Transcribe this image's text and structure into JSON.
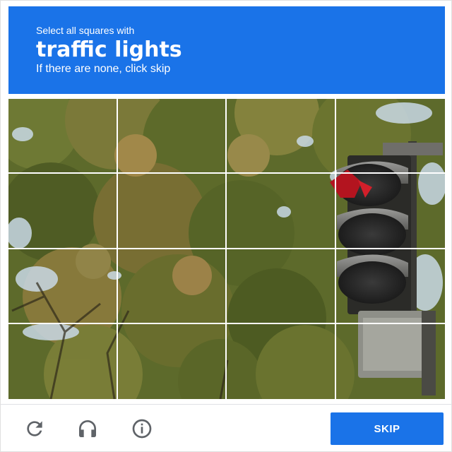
{
  "header": {
    "instruction": "Select all squares with",
    "target": "traffic lights",
    "hint": "If there are none, click skip"
  },
  "grid": {
    "rows": 4,
    "columns": 4,
    "image_description_icons": [
      "tree-foliage",
      "traffic-light"
    ]
  },
  "footer": {
    "reload_icon": "reload-icon",
    "audio_icon": "headphones-icon",
    "info_icon": "info-icon",
    "skip_label": "SKIP"
  },
  "colors": {
    "accent": "#1a73e8",
    "icon": "#5f6368",
    "grid_line": "#ffffff"
  }
}
